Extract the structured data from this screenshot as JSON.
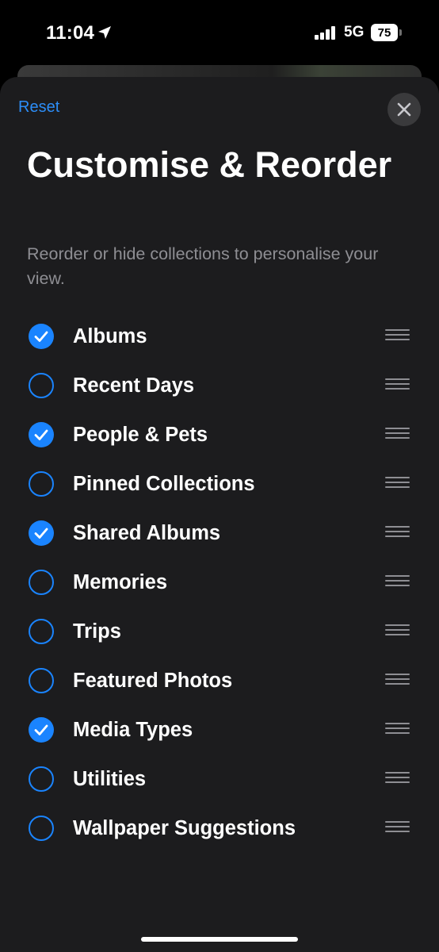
{
  "status_bar": {
    "time": "11:04",
    "network": "5G",
    "battery": "75",
    "icons": [
      "location-arrow-icon",
      "cellular-signal-icon",
      "battery-icon"
    ]
  },
  "sheet": {
    "reset_label": "Reset",
    "close_icon": "close-icon",
    "title": "Customise & Reorder",
    "subtitle": "Reorder or hide collections to personalise your view."
  },
  "collections": [
    {
      "label": "Albums",
      "checked": true
    },
    {
      "label": "Recent Days",
      "checked": false
    },
    {
      "label": "People & Pets",
      "checked": true
    },
    {
      "label": "Pinned Collections",
      "checked": false
    },
    {
      "label": "Shared Albums",
      "checked": true
    },
    {
      "label": "Memories",
      "checked": false
    },
    {
      "label": "Trips",
      "checked": false
    },
    {
      "label": "Featured Photos",
      "checked": false
    },
    {
      "label": "Media Types",
      "checked": true
    },
    {
      "label": "Utilities",
      "checked": false
    },
    {
      "label": "Wallpaper Suggestions",
      "checked": false
    }
  ],
  "colors": {
    "accent": "#1a84ff",
    "link": "#2c8df7",
    "sheet_background": "#1c1c1e",
    "secondary_text": "#8e8e93"
  }
}
